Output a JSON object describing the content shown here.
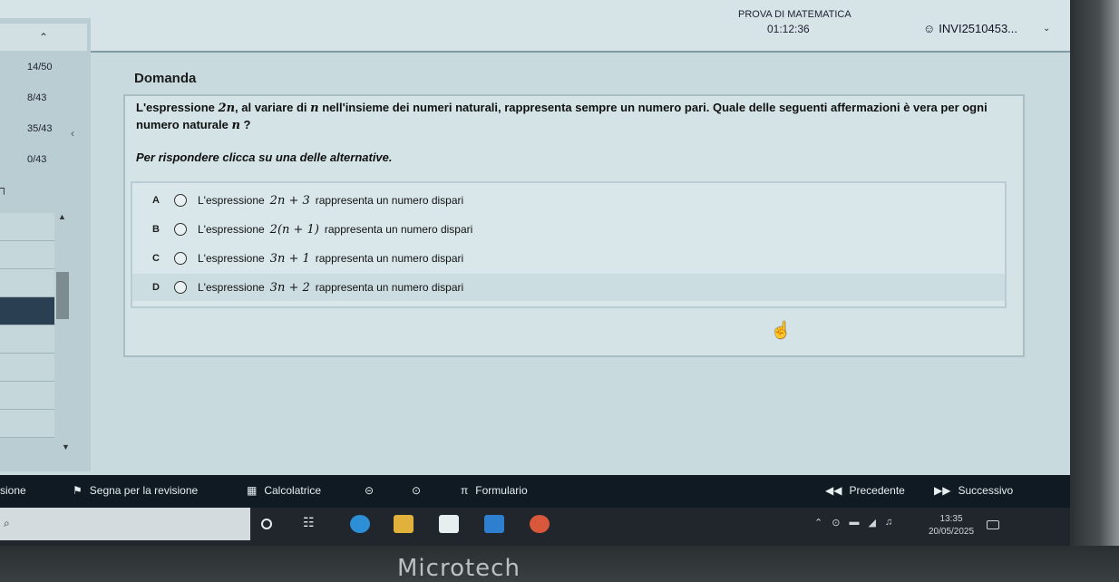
{
  "header": {
    "exam_title": "PROVA DI MATEMATICA",
    "timer": "01:12:36",
    "user_id": "INVI2510453..."
  },
  "sidebar": {
    "stats": [
      "14/50",
      "8/43",
      "35/43",
      "0/43"
    ]
  },
  "question": {
    "heading": "Domanda",
    "text_parts": {
      "p1": "L'espressione ",
      "m1": "2n",
      "p2": ", al variare di ",
      "m2": "n",
      "p3": " nell'insieme dei numeri naturali, rappresenta sempre un numero pari. Quale delle seguenti affermazioni è vera per ogni numero naturale ",
      "m3": "n",
      "p4": " ?"
    },
    "instruction": "Per rispondere clicca su una delle alternative."
  },
  "options": [
    {
      "letter": "A",
      "pre": "L'espressione",
      "math": "2n + 3",
      "post": "rappresenta un numero dispari"
    },
    {
      "letter": "B",
      "pre": "L'espressione",
      "math": "2(n + 1)",
      "post": "rappresenta un numero dispari"
    },
    {
      "letter": "C",
      "pre": "L'espressione",
      "math": "3n + 1",
      "post": "rappresenta un numero dispari"
    },
    {
      "letter": "D",
      "pre": "L'espressione",
      "math": "3n + 2",
      "post": "rappresenta un numero dispari"
    }
  ],
  "toolbar": {
    "left_cut": "sione",
    "review": "Segna per la revisione",
    "calculator": "Calcolatrice",
    "formulary": "Formulario",
    "prev": "Precedente",
    "next": "Successivo"
  },
  "taskbar": {
    "time": "13:35",
    "date": "20/05/2025"
  },
  "brand": "Microtech"
}
